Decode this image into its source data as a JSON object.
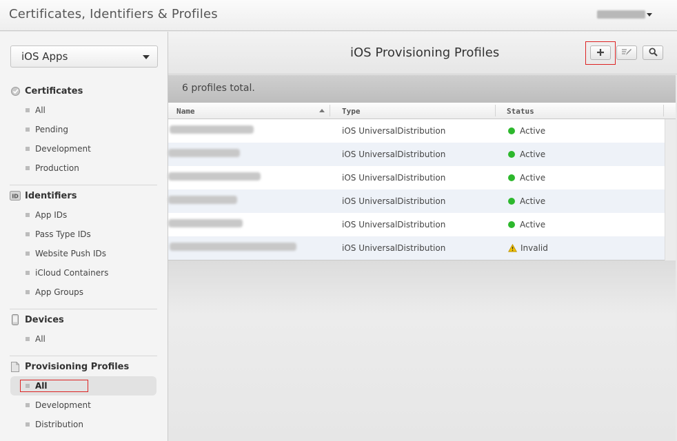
{
  "header": {
    "title": "Certificates, Identifiers & Profiles"
  },
  "sidebar": {
    "app_select": "iOS Apps",
    "sections": [
      {
        "title": "Certificates",
        "icon": "certificate-icon",
        "items": [
          "All",
          "Pending",
          "Development",
          "Production"
        ]
      },
      {
        "title": "Identifiers",
        "icon": "id-icon",
        "items": [
          "App IDs",
          "Pass Type IDs",
          "Website Push IDs",
          "iCloud Containers",
          "App Groups"
        ]
      },
      {
        "title": "Devices",
        "icon": "device-icon",
        "items": [
          "All"
        ]
      },
      {
        "title": "Provisioning Profiles",
        "icon": "document-icon",
        "items": [
          "All",
          "Development",
          "Distribution"
        ]
      }
    ],
    "active_item": "Provisioning Profiles > All"
  },
  "main": {
    "title": "iOS Provisioning Profiles",
    "toolbar": {
      "add_icon": "plus-icon",
      "edit_icon": "edit-icon",
      "search_icon": "search-icon"
    },
    "count_text": "6 profiles total.",
    "columns": [
      "Name",
      "Type",
      "Status"
    ],
    "rows": [
      {
        "type": "iOS UniversalDistribution",
        "status": "Active"
      },
      {
        "type": "iOS UniversalDistribution",
        "status": "Active"
      },
      {
        "type": "iOS UniversalDistribution",
        "status": "Active"
      },
      {
        "type": "iOS UniversalDistribution",
        "status": "Active"
      },
      {
        "type": "iOS UniversalDistribution",
        "status": "Active"
      },
      {
        "type": "iOS UniversalDistribution",
        "status": "Invalid"
      }
    ]
  },
  "colors": {
    "active": "#2db82d",
    "warning": "#e8b400",
    "highlight": "#dd2222"
  }
}
